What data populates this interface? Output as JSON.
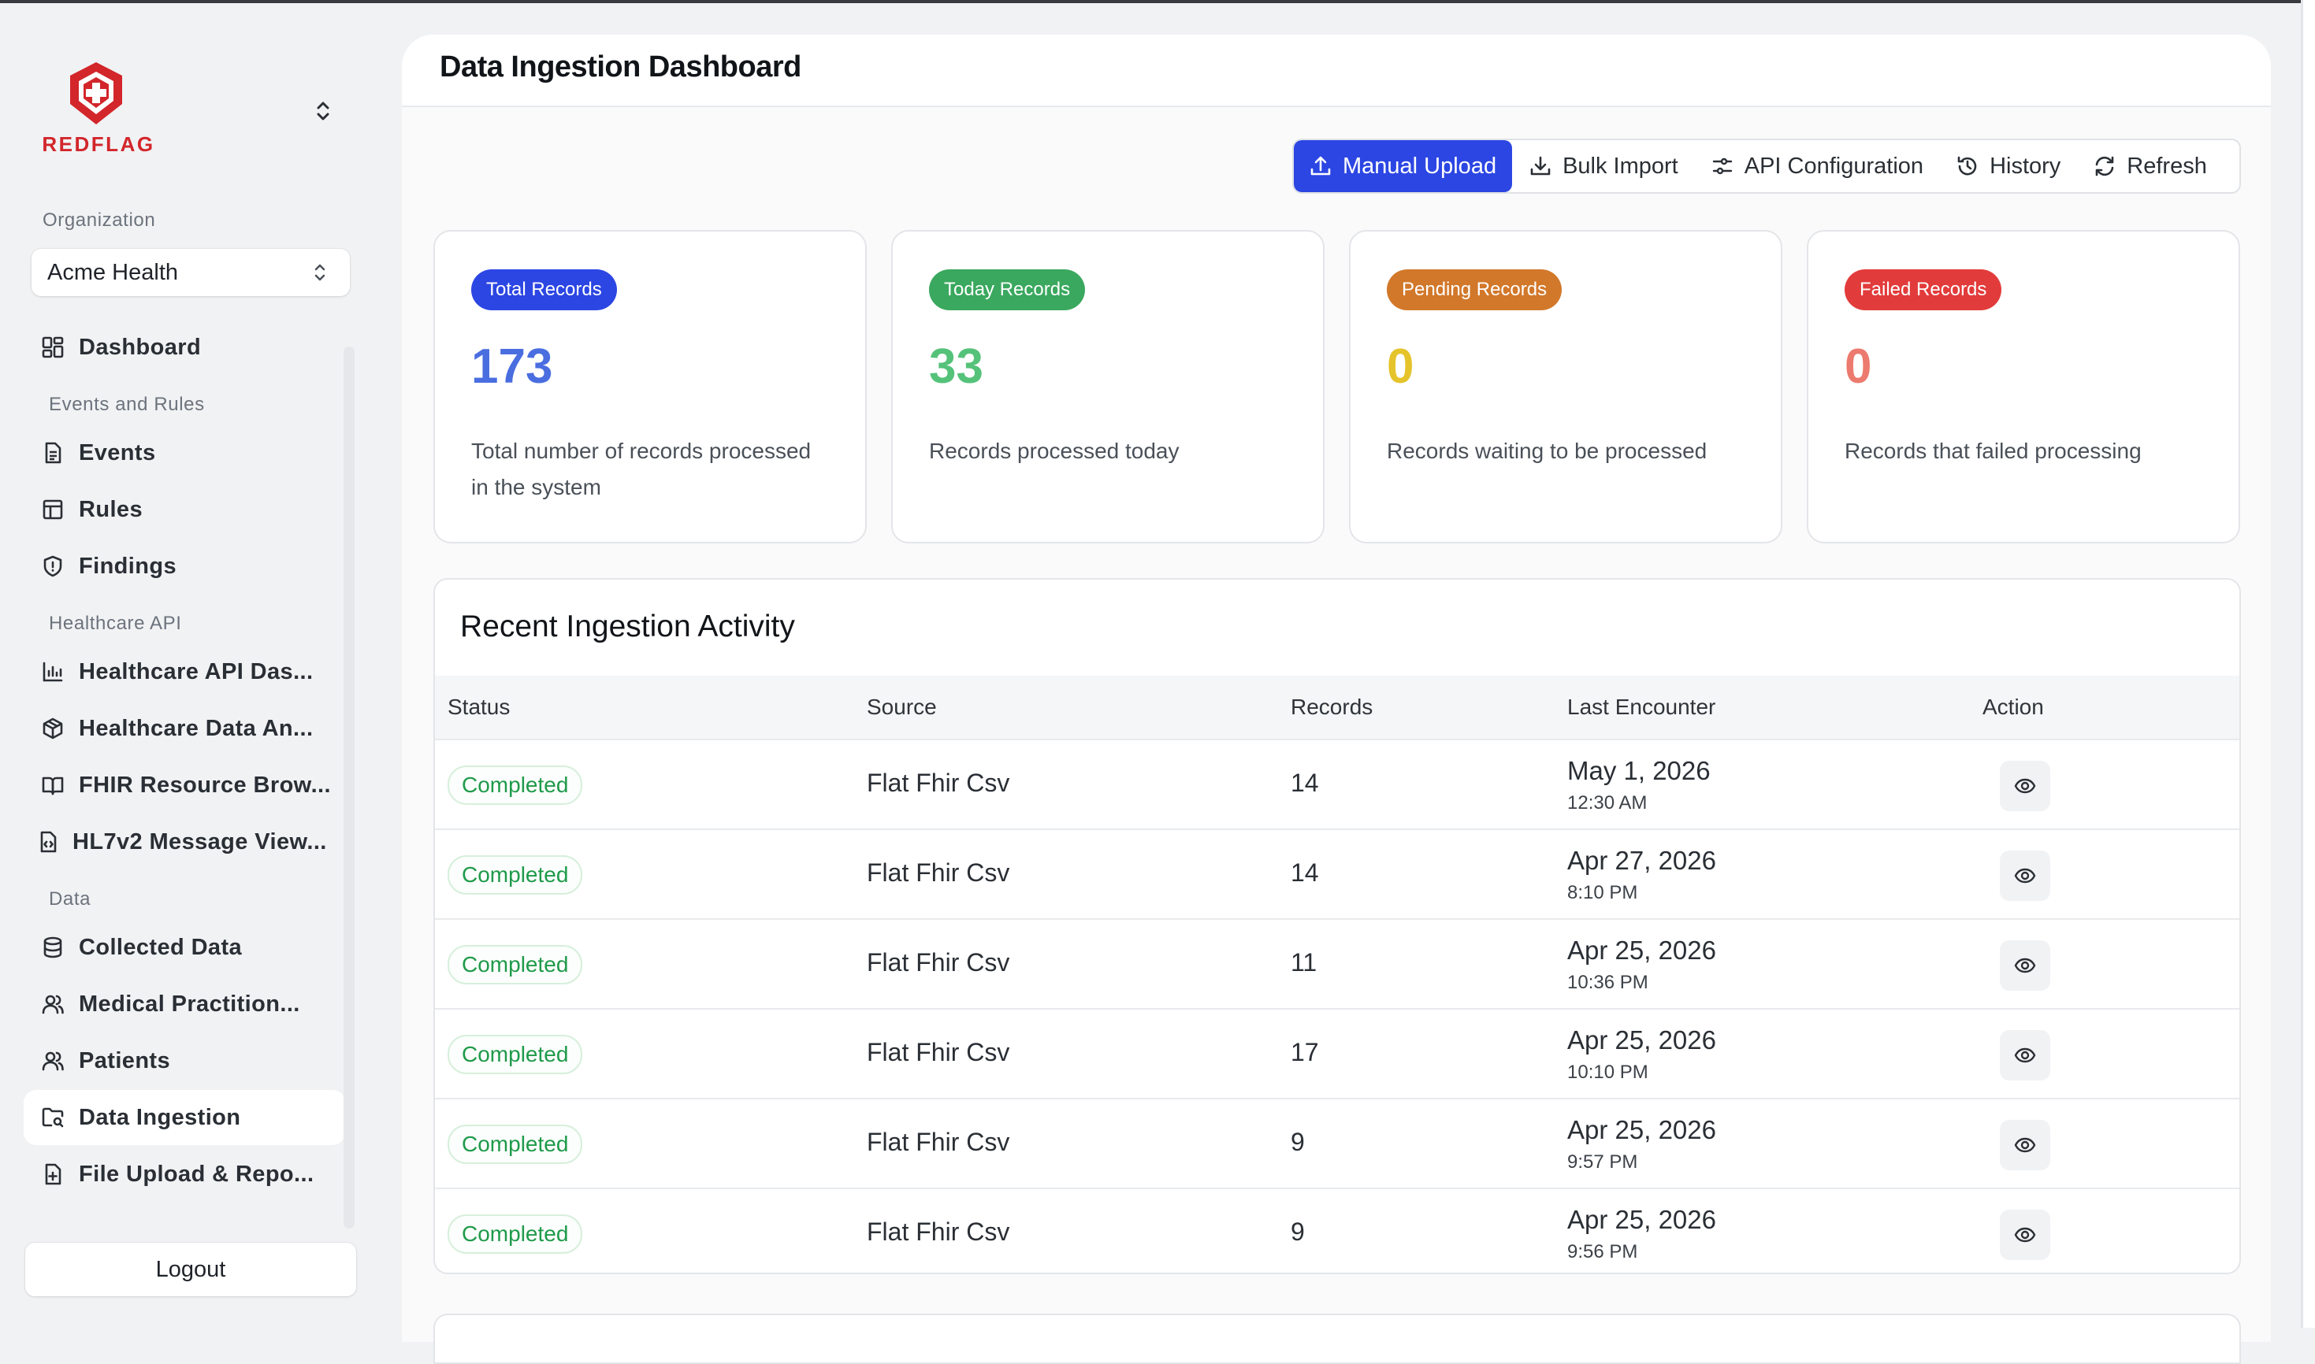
{
  "brand": {
    "name": "REDFLAG"
  },
  "sidebar": {
    "organization_label": "Organization",
    "organization_value": "Acme Health",
    "sections": {
      "events_rules": "Events and Rules",
      "healthcare_api": "Healthcare API",
      "data": "Data"
    },
    "items": [
      {
        "label": "Dashboard",
        "icon": "dashboard-grid-icon"
      },
      {
        "label": "Events",
        "icon": "document-icon"
      },
      {
        "label": "Rules",
        "icon": "table-icon"
      },
      {
        "label": "Findings",
        "icon": "shield-alert-icon"
      },
      {
        "label": "Healthcare API Das...",
        "icon": "bar-chart-icon"
      },
      {
        "label": "Healthcare Data An...",
        "icon": "box-icon"
      },
      {
        "label": "FHIR Resource Brow...",
        "icon": "book-open-icon"
      },
      {
        "label": "HL7v2 Message View...",
        "icon": "file-code-icon"
      },
      {
        "label": "Collected Data",
        "icon": "database-icon"
      },
      {
        "label": "Medical Practition...",
        "icon": "users-icon"
      },
      {
        "label": "Patients",
        "icon": "users-icon"
      },
      {
        "label": "Data Ingestion",
        "icon": "folder-search-icon",
        "active": true
      },
      {
        "label": "File Upload & Repo...",
        "icon": "file-plus-icon"
      }
    ],
    "logout_label": "Logout"
  },
  "header": {
    "title": "Data Ingestion Dashboard"
  },
  "toolbar": {
    "manual_upload": "Manual Upload",
    "bulk_import": "Bulk Import",
    "api_configuration": "API Configuration",
    "history": "History",
    "refresh": "Refresh"
  },
  "stats": [
    {
      "badge": "Total Records",
      "value": "173",
      "desc": "Total number of records processed in the system",
      "badge_color": "#2c46e3",
      "value_color": "#4a6ee0"
    },
    {
      "badge": "Today Records",
      "value": "33",
      "desc": "Records processed today",
      "badge_color": "#3aa85e",
      "value_color": "#55c27a"
    },
    {
      "badge": "Pending Records",
      "value": "0",
      "desc": "Records waiting to be processed",
      "badge_color": "#d2782a",
      "value_color": "#e5c32a"
    },
    {
      "badge": "Failed Records",
      "value": "0",
      "desc": "Records that failed processing",
      "badge_color": "#e23b3b",
      "value_color": "#ec7a6e"
    }
  ],
  "activity": {
    "title": "Recent Ingestion Activity",
    "columns": [
      "Status",
      "Source",
      "Records",
      "Last Encounter",
      "Action"
    ],
    "rows": [
      {
        "status": "Completed",
        "source": "Flat Fhir Csv",
        "records": "14",
        "date": "May 1, 2026",
        "time": "12:30 AM"
      },
      {
        "status": "Completed",
        "source": "Flat Fhir Csv",
        "records": "14",
        "date": "Apr 27, 2026",
        "time": "8:10 PM"
      },
      {
        "status": "Completed",
        "source": "Flat Fhir Csv",
        "records": "11",
        "date": "Apr 25, 2026",
        "time": "10:36 PM"
      },
      {
        "status": "Completed",
        "source": "Flat Fhir Csv",
        "records": "17",
        "date": "Apr 25, 2026",
        "time": "10:10 PM"
      },
      {
        "status": "Completed",
        "source": "Flat Fhir Csv",
        "records": "9",
        "date": "Apr 25, 2026",
        "time": "9:57 PM"
      },
      {
        "status": "Completed",
        "source": "Flat Fhir Csv",
        "records": "9",
        "date": "Apr 25, 2026",
        "time": "9:56 PM"
      }
    ]
  }
}
